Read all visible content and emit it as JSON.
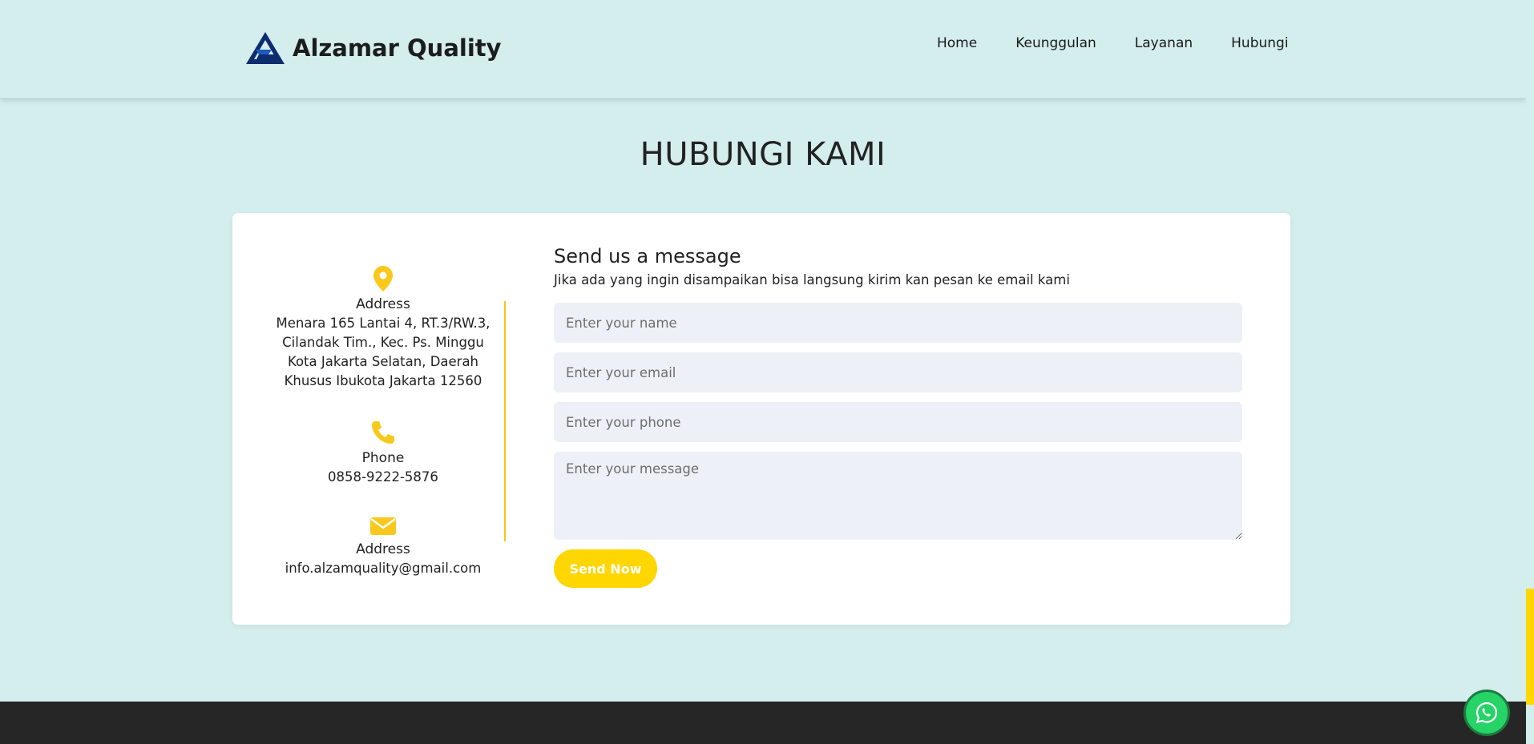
{
  "brand": {
    "name": "Alzamar Quality"
  },
  "nav": {
    "items": [
      {
        "label": "Home"
      },
      {
        "label": "Keunggulan"
      },
      {
        "label": "Layanan"
      },
      {
        "label": "Hubungi"
      }
    ]
  },
  "page": {
    "title": "HUBUNGI KAMI"
  },
  "contact_info": {
    "address": {
      "label": "Address",
      "value": "Menara 165 Lantai 4, RT.3/RW.3, Cilandak Tim., Kec. Ps. Minggu Kota Jakarta Selatan, Daerah Khusus Ibukota Jakarta 12560",
      "icon": "map-pin-icon"
    },
    "phone": {
      "label": "Phone",
      "value": "0858-9222-5876",
      "icon": "phone-icon"
    },
    "email": {
      "label": "Address",
      "value": "info.alzamquality@gmail.com",
      "icon": "envelope-icon"
    }
  },
  "form": {
    "title": "Send us a message",
    "subtitle": "Jika ada yang ingin disampaikan bisa langsung kirim kan pesan ke email kami",
    "name_placeholder": "Enter your name",
    "email_placeholder": "Enter your email",
    "phone_placeholder": "Enter your phone",
    "message_placeholder": "Enter your message",
    "submit_label": "Send Now"
  },
  "colors": {
    "background": "#d4eded",
    "accent": "#ffd600",
    "footer": "#262626",
    "whatsapp": "#25d366"
  }
}
